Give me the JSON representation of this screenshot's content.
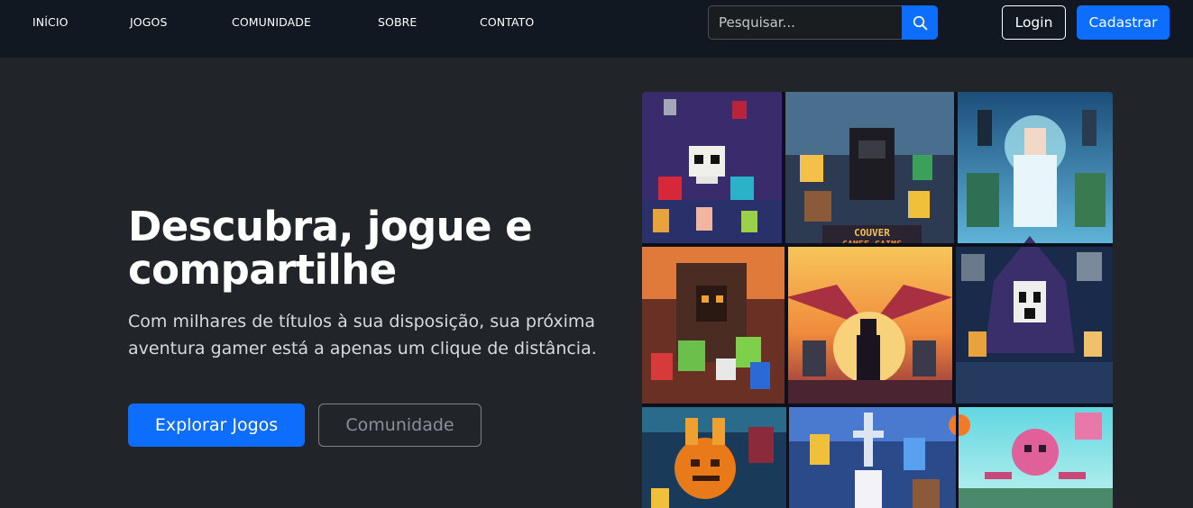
{
  "nav": {
    "items": [
      {
        "label": "INÍCIO"
      },
      {
        "label": "JOGOS"
      },
      {
        "label": "COMUNIDADE"
      },
      {
        "label": "SOBRE"
      },
      {
        "label": "CONTATO"
      }
    ],
    "search": {
      "placeholder": "Pesquisar...",
      "icon": "search-icon"
    },
    "login_label": "Login",
    "signup_label": "Cadastrar"
  },
  "hero": {
    "title": "Descubra, jogue e compartilhe",
    "text": "Com milhares de títulos à sua disposição, sua próxima aventura gamer está a apenas um clique de distância.",
    "primary_button": "Explorar Jogos",
    "secondary_button": "Comunidade",
    "image": {
      "caption_line1": "COUVER",
      "caption_line2": "CAMEE GAIMS"
    }
  },
  "colors": {
    "navbar": "#121821",
    "background": "#212529",
    "accent": "#0d6efd"
  }
}
